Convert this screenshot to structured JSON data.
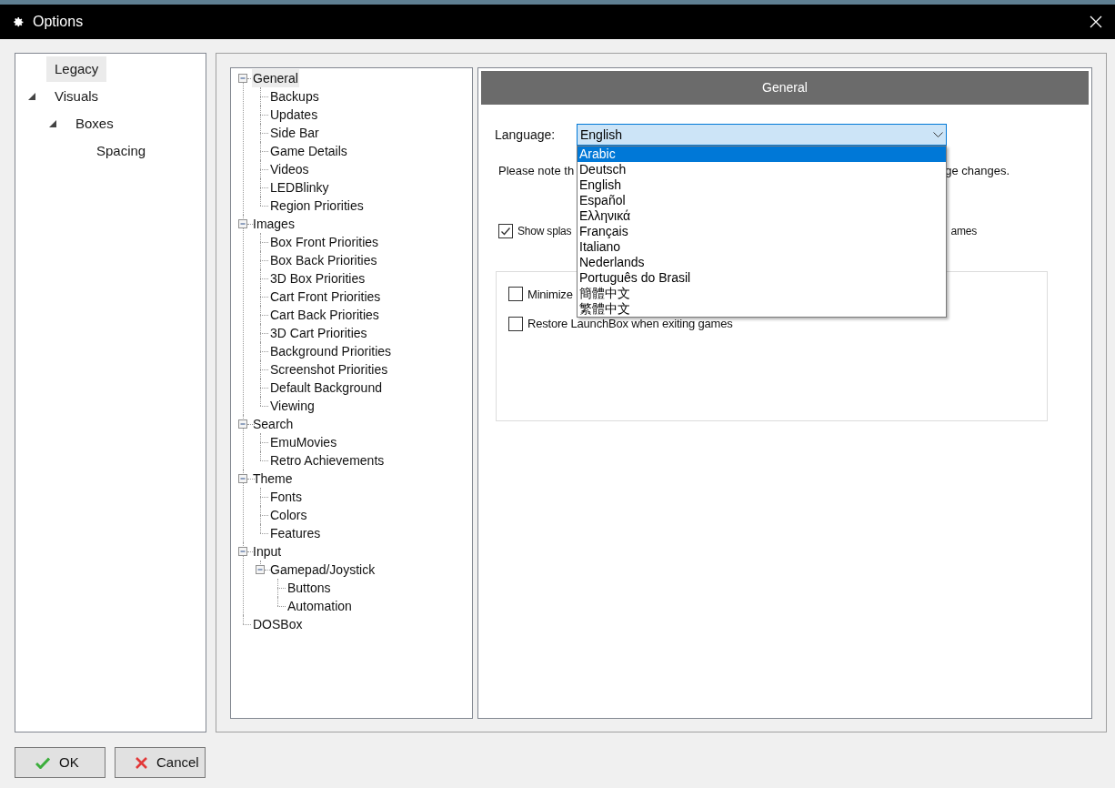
{
  "window": {
    "title": "Options"
  },
  "categories": [
    {
      "label": "Legacy",
      "selected": true
    },
    {
      "label": "Visuals",
      "selected": false,
      "expanded": true,
      "children": [
        {
          "label": "Boxes",
          "selected": false,
          "expanded": true,
          "children": [
            {
              "label": "Spacing",
              "selected": false
            }
          ]
        }
      ]
    }
  ],
  "settings_tree": [
    {
      "label": "General",
      "selected": true,
      "expanded": true,
      "children": [
        {
          "label": "Backups",
          "selected": false
        },
        {
          "label": "Updates",
          "selected": false
        },
        {
          "label": "Side Bar",
          "selected": false
        },
        {
          "label": "Game Details",
          "selected": false
        },
        {
          "label": "Videos",
          "selected": false
        },
        {
          "label": "LEDBlinky",
          "selected": false
        },
        {
          "label": "Region Priorities",
          "selected": false
        }
      ]
    },
    {
      "label": "Images",
      "selected": false,
      "expanded": true,
      "children": [
        {
          "label": "Box Front Priorities",
          "selected": false
        },
        {
          "label": "Box Back Priorities",
          "selected": false
        },
        {
          "label": "3D Box Priorities",
          "selected": false
        },
        {
          "label": "Cart Front Priorities",
          "selected": false
        },
        {
          "label": "Cart Back Priorities",
          "selected": false
        },
        {
          "label": "3D Cart Priorities",
          "selected": false
        },
        {
          "label": "Background Priorities",
          "selected": false
        },
        {
          "label": "Screenshot Priorities",
          "selected": false
        },
        {
          "label": "Default Background",
          "selected": false
        },
        {
          "label": "Viewing",
          "selected": false
        }
      ]
    },
    {
      "label": "Search",
      "selected": false,
      "expanded": true,
      "children": [
        {
          "label": "EmuMovies",
          "selected": false
        },
        {
          "label": "Retro Achievements",
          "selected": false
        }
      ]
    },
    {
      "label": "Theme",
      "selected": false,
      "expanded": true,
      "children": [
        {
          "label": "Fonts",
          "selected": false
        },
        {
          "label": "Colors",
          "selected": false
        },
        {
          "label": "Features",
          "selected": false
        }
      ]
    },
    {
      "label": "Input",
      "selected": false,
      "expanded": true,
      "children": [
        {
          "label": "Gamepad/Joystick",
          "selected": false,
          "expanded": true,
          "children": [
            {
              "label": "Buttons",
              "selected": false
            },
            {
              "label": "Automation",
              "selected": false
            }
          ]
        }
      ]
    },
    {
      "label": "DOSBox",
      "selected": false
    }
  ],
  "panel": {
    "header": "General",
    "language": {
      "label": "Language:",
      "value": "English",
      "options": [
        {
          "label": "Arabic",
          "highlighted": true
        },
        {
          "label": "Deutsch",
          "highlighted": false
        },
        {
          "label": "English",
          "highlighted": false
        },
        {
          "label": "Español",
          "highlighted": false
        },
        {
          "label": "Ελληνικά",
          "highlighted": false
        },
        {
          "label": "Français",
          "highlighted": false
        },
        {
          "label": "Italiano",
          "highlighted": false
        },
        {
          "label": "Nederlands",
          "highlighted": false
        },
        {
          "label": "Português do Brasil",
          "highlighted": false
        },
        {
          "label": "簡體中文",
          "highlighted": false
        },
        {
          "label": "繁體中文",
          "highlighted": false
        }
      ]
    },
    "note": [
      "Please note th",
      "ge changes."
    ],
    "splash": {
      "checked": true,
      "text": [
        "Show splas",
        "ames"
      ]
    },
    "group": [
      {
        "label": "Minimize",
        "checked": false
      },
      {
        "label": "Restore LaunchBox when exiting games",
        "checked": false
      }
    ]
  },
  "buttons": [
    {
      "label": "OK",
      "kind": "ok"
    },
    {
      "label": "Cancel",
      "kind": "cancel"
    }
  ]
}
